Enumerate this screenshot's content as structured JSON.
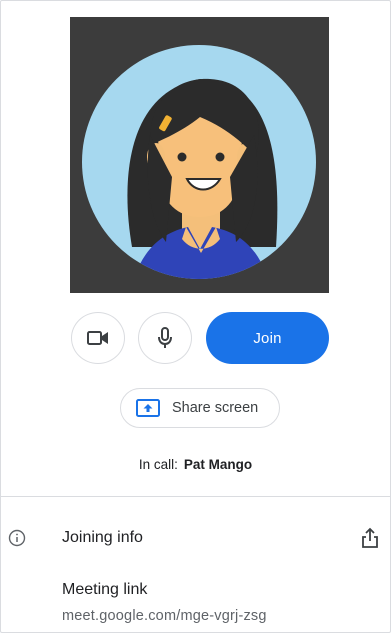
{
  "controls": {
    "camera_icon": "video-camera-icon",
    "mic_icon": "microphone-icon",
    "join_label": "Join",
    "accent": "#1a73e8"
  },
  "share": {
    "icon": "present-screen-icon",
    "label": "Share screen"
  },
  "status": {
    "prefix": "In call:",
    "name": "Pat Mango"
  },
  "joining": {
    "info_icon": "info-icon",
    "title": "Joining info",
    "share_icon": "share-export-icon",
    "link_title": "Meeting link",
    "link_url": "meet.google.com/mge-vgrj-zsg"
  }
}
